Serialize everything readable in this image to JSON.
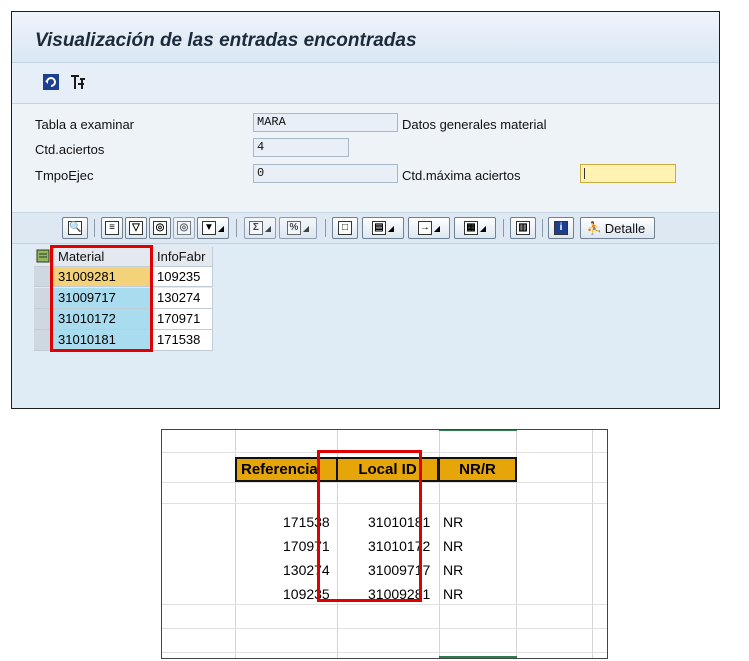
{
  "window": {
    "title": "Visualización de las entradas encontradas"
  },
  "toolbar": {
    "icons": [
      "refresh-icon",
      "technical-settings-icon"
    ]
  },
  "form": {
    "tabla_label": "Tabla a examinar",
    "tabla_value": "MARA",
    "tabla_desc": "Datos generales material",
    "aciertos_label": "Ctd.aciertos",
    "aciertos_value": "4",
    "tiempo_label": "TmpoEjec",
    "tiempo_value": "0",
    "max_label": "Ctd.máxima aciertos",
    "max_value": ""
  },
  "alv_toolbar": {
    "detalle_label": "Detalle",
    "icons": [
      "details-icon",
      "print-icon",
      "filter-icon",
      "find-icon",
      "find-next-icon",
      "set-filter-icon",
      "sum-icon",
      "subtotal-icon",
      "print-preview-icon",
      "views-icon",
      "export-icon",
      "change-layout-icon",
      "graphic-icon",
      "info-icon",
      "detalle-icon"
    ]
  },
  "grid": {
    "columns": [
      "Material",
      "InfoFabr"
    ],
    "rows": [
      {
        "material": "31009281",
        "info": "109235",
        "selected": true
      },
      {
        "material": "31009717",
        "info": "130274",
        "selected": false
      },
      {
        "material": "31010172",
        "info": "170971",
        "selected": false
      },
      {
        "material": "31010181",
        "info": "171538",
        "selected": false
      }
    ]
  },
  "excel": {
    "headers": [
      "Referencia",
      "Local ID",
      "NR/R"
    ],
    "rows": [
      {
        "ref": "171538",
        "local": "31010181",
        "nr": "NR"
      },
      {
        "ref": "170971",
        "local": "31010172",
        "nr": "NR"
      },
      {
        "ref": "130274",
        "local": "31009717",
        "nr": "NR"
      },
      {
        "ref": "109235",
        "local": "31009281",
        "nr": "NR"
      }
    ]
  },
  "colors": {
    "highlight_red": "#e00000",
    "excel_header": "#e6a60a",
    "sap_selected": "#f4d27a",
    "sap_key": "#a9dcee"
  }
}
